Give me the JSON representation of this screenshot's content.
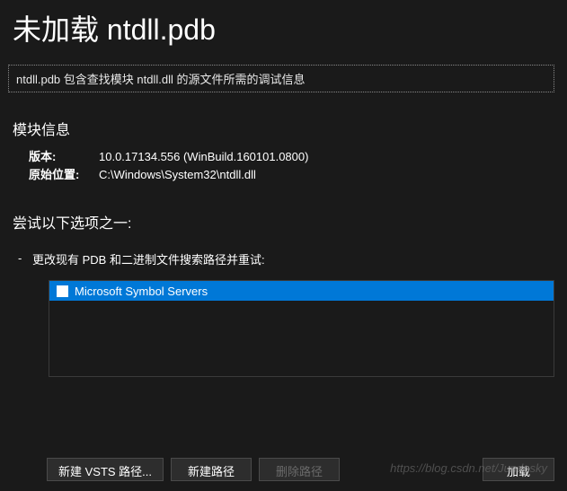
{
  "title": "未加载 ntdll.pdb",
  "info_box": "ntdll.pdb 包含查找模块 ntdll.dll 的源文件所需的调试信息",
  "module_info": {
    "heading": "模块信息",
    "rows": [
      {
        "label": "版本:",
        "value": "10.0.17134.556 (WinBuild.160101.0800)"
      },
      {
        "label": "原始位置:",
        "value": "C:\\Windows\\System32\\ntdll.dll"
      }
    ]
  },
  "options": {
    "heading": "尝试以下选项之一:",
    "bullet": "-",
    "item_text": "更改现有 PDB 和二进制文件搜索路径并重试:",
    "list_items": [
      {
        "label": "Microsoft Symbol Servers",
        "checked": false,
        "selected": true
      }
    ]
  },
  "buttons": {
    "new_vsts": "新建 VSTS 路径...",
    "new_path": "新建路径",
    "delete_path": "删除路径",
    "load": "加载"
  },
  "watermark": "https://blog.csdn.net/Jundesky"
}
